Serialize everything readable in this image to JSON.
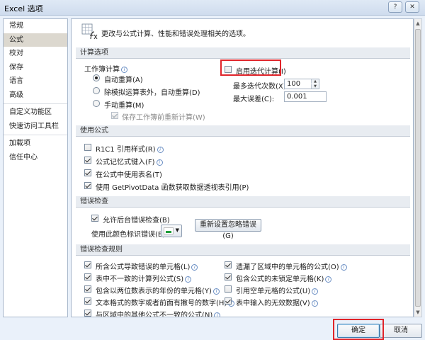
{
  "window": {
    "title": "Excel 选项",
    "help_glyph": "?",
    "close_glyph": "✕"
  },
  "sidebar": {
    "items": [
      {
        "label": "常规"
      },
      {
        "label": "公式",
        "selected": true
      },
      {
        "label": "校对"
      },
      {
        "label": "保存"
      },
      {
        "label": "语言"
      },
      {
        "label": "高级"
      },
      {
        "label": "自定义功能区"
      },
      {
        "label": "快速访问工具栏"
      },
      {
        "label": "加载项"
      },
      {
        "label": "信任中心"
      }
    ]
  },
  "header": {
    "text": "更改与公式计算、性能和错误处理相关的选项。"
  },
  "calc": {
    "section_title": "计算选项",
    "workbook_calc_label": "工作簿计算",
    "auto": "自动重算(A)",
    "auto_except": "除模拟运算表外，自动重算(D)",
    "manual": "手动重算(M)",
    "recalc_before_save": "保存工作簿前重新计算(W)",
    "enable_iterative": "启用迭代计算(I)",
    "max_iterations_label": "最多迭代次数(X):",
    "max_iterations_value": "100",
    "max_change_label": "最大误差(C):",
    "max_change_value": "0.001"
  },
  "formulas": {
    "section_title": "使用公式",
    "r1c1": "R1C1 引用样式(R)",
    "autocomplete": "公式记忆式键入(F)",
    "table_names": "在公式中使用表名(T)",
    "getpivotdata": "使用 GetPivotData 函数获取数据透视表引用(P)"
  },
  "error_checking": {
    "section_title": "错误检查",
    "enable_background": "允许后台错误检查(B)",
    "color_label": "使用此颜色标识错误(E):",
    "reset_button": "重新设置忽略错误(G)"
  },
  "error_rules": {
    "section_title": "错误检查规则",
    "left": [
      {
        "label": "所含公式导致错误的单元格(L)",
        "checked": true
      },
      {
        "label": "表中不一致的计算列公式(S)",
        "checked": true
      },
      {
        "label": "包含以两位数表示的年份的单元格(Y)",
        "checked": true
      },
      {
        "label": "文本格式的数字或者前面有撇号的数字(H)",
        "checked": true
      },
      {
        "label": "与区域中的其他公式不一致的公式(N)",
        "checked": true
      }
    ],
    "right": [
      {
        "label": "遗漏了区域中的单元格的公式(O)",
        "checked": true
      },
      {
        "label": "包含公式的未锁定单元格(K)",
        "checked": true
      },
      {
        "label": "引用空单元格的公式(U)",
        "checked": false
      },
      {
        "label": "表中输入的无效数据(V)",
        "checked": true
      }
    ]
  },
  "footer": {
    "ok": "确定",
    "cancel": "取消"
  },
  "colors": {
    "highlight_red": "#e0242a",
    "info_blue": "#3a6db5",
    "error_marker_green": "#1f9d3a"
  }
}
